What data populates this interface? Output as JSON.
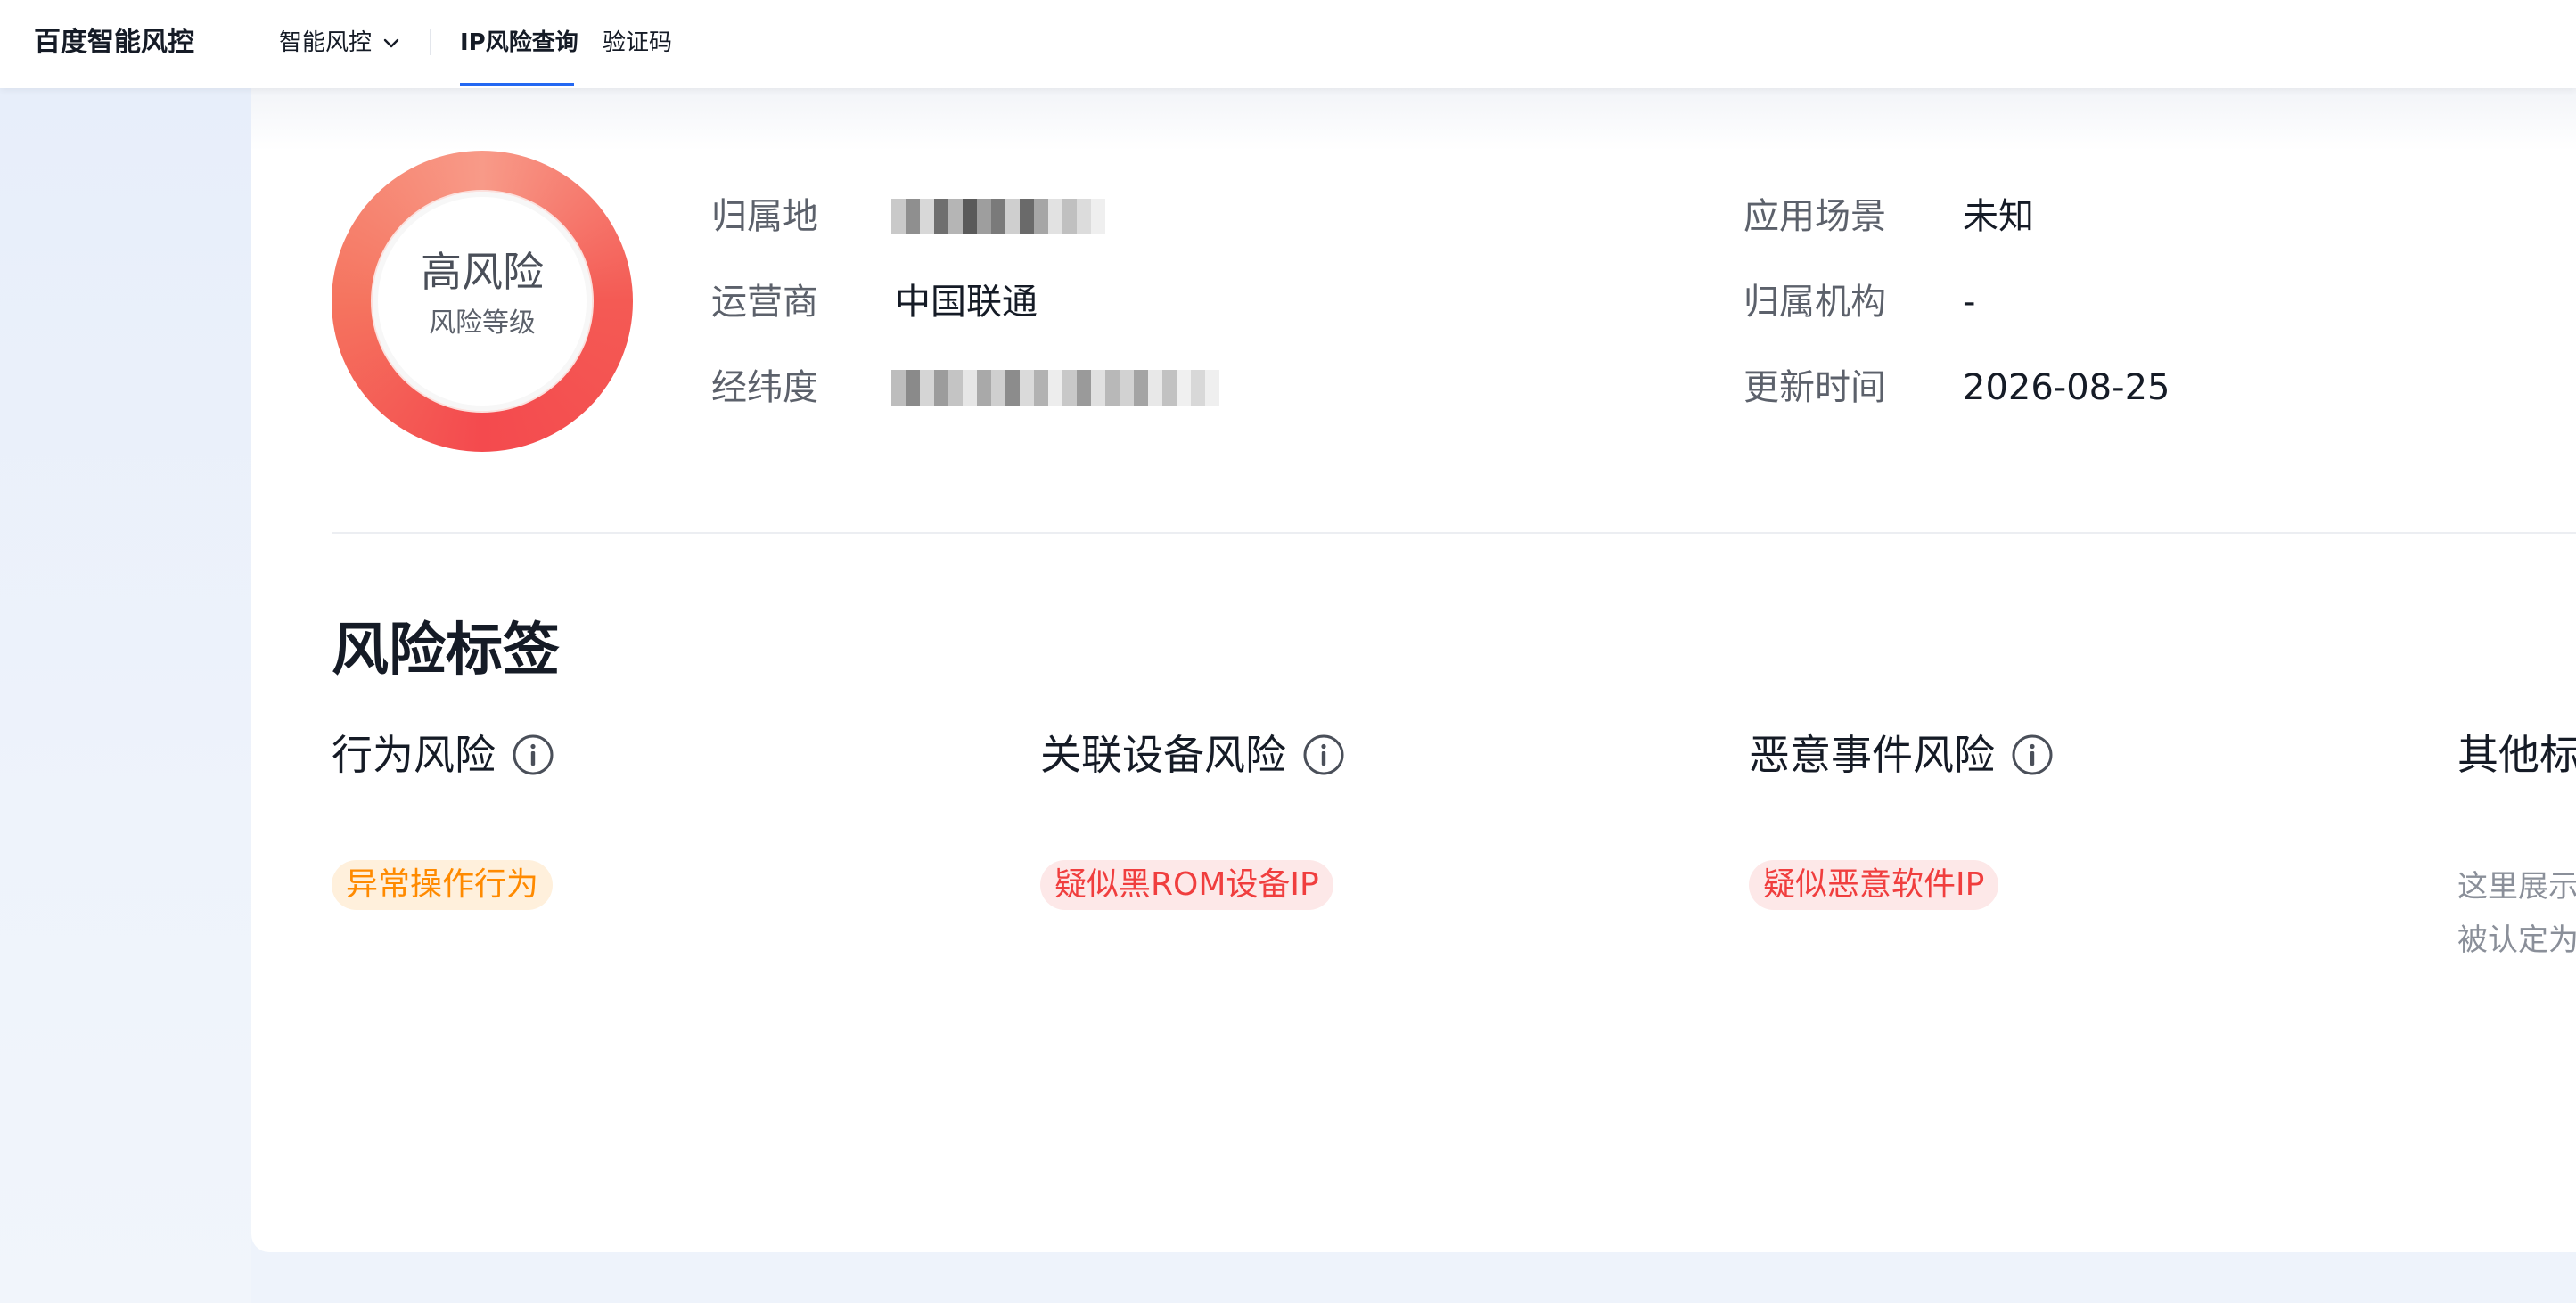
{
  "nav": {
    "brand": "百度智能风控",
    "dropdown_label": "智能风控",
    "active_tab": "IP风险查询",
    "captcha_tab": "验证码"
  },
  "risk": {
    "level": "高风险",
    "caption": "风险等级"
  },
  "info": {
    "location_label": "归属地",
    "isp_label": "运营商",
    "isp_value": "中国联通",
    "latlng_label": "经纬度",
    "scene_label": "应用场景",
    "scene_value": "未知",
    "org_label": "归属机构",
    "org_value": "-",
    "updated_label": "更新时间",
    "updated_value": "2026-08-25"
  },
  "tags_section": {
    "title": "风险标签",
    "columns": [
      {
        "title": "行为风险",
        "tag": "异常操作行为",
        "tag_color": "#ff8a00"
      },
      {
        "title": "关联设备风险",
        "tag": "疑似黑ROM设备IP",
        "tag_color": "#f03e3e"
      },
      {
        "title": "恶意事件风险",
        "tag": "疑似恶意软件IP",
        "tag_color": "#f03e3e"
      },
      {
        "title": "其他标",
        "desc_line1": "这里展示",
        "desc_line2": "被认定为"
      }
    ]
  },
  "colors": {
    "accent": "#2468f2",
    "risk_high": "#f44a4e",
    "tag_orange": "#ff8a00",
    "tag_red": "#f03e3e"
  }
}
